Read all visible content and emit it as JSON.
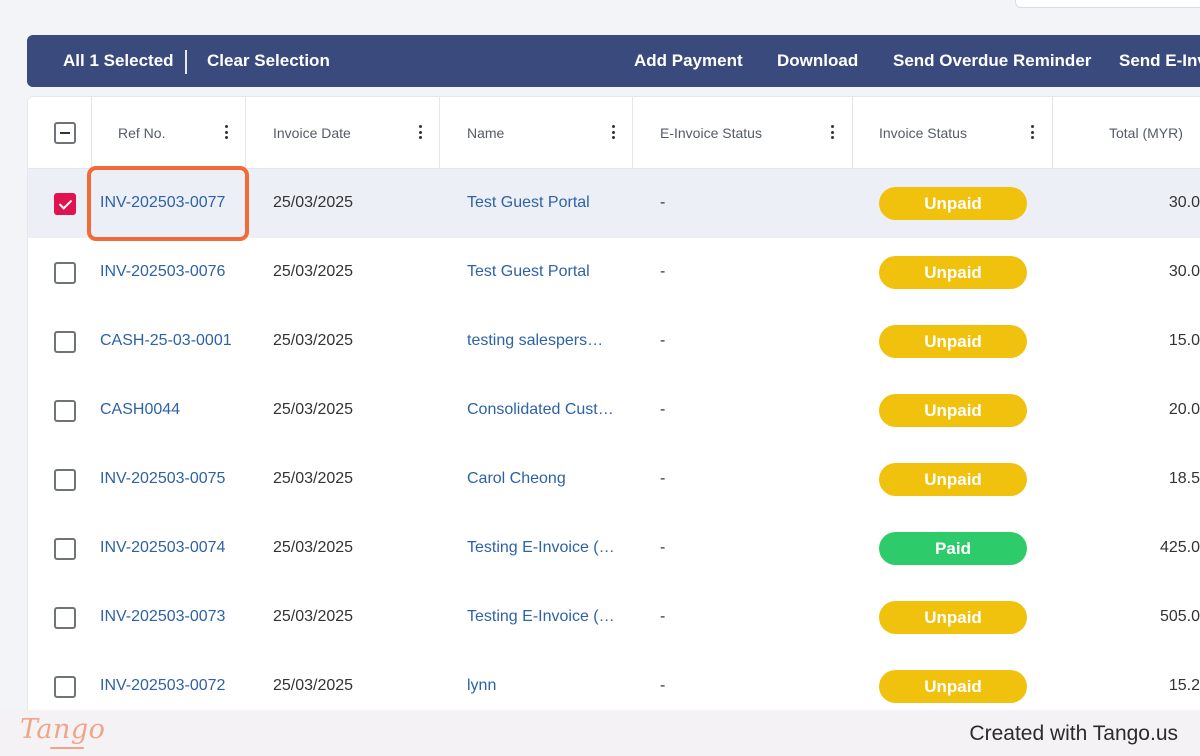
{
  "action_bar": {
    "selection_count": "All 1 Selected",
    "clear_selection": "Clear Selection",
    "add_payment": "Add Payment",
    "download": "Download",
    "send_overdue_reminder": "Send Overdue Reminder",
    "send_einvoice": "Send E-Inv"
  },
  "table": {
    "columns": [
      "Ref No.",
      "Invoice Date",
      "Name",
      "E-Invoice Status",
      "Invoice Status",
      "Total (MYR)"
    ],
    "rows": [
      {
        "ref": "INV-202503-0077",
        "date": "25/03/2025",
        "name": "Test Guest Portal",
        "einvoice_status": "-",
        "status": "Unpaid",
        "total": "30.0",
        "selected": true
      },
      {
        "ref": "INV-202503-0076",
        "date": "25/03/2025",
        "name": "Test Guest Portal",
        "einvoice_status": "-",
        "status": "Unpaid",
        "total": "30.0",
        "selected": false
      },
      {
        "ref": "CASH-25-03-0001",
        "date": "25/03/2025",
        "name": "testing salespers…",
        "einvoice_status": "-",
        "status": "Unpaid",
        "total": "15.0",
        "selected": false
      },
      {
        "ref": "CASH0044",
        "date": "25/03/2025",
        "name": "Consolidated Cust…",
        "einvoice_status": "-",
        "status": "Unpaid",
        "total": "20.0",
        "selected": false
      },
      {
        "ref": "INV-202503-0075",
        "date": "25/03/2025",
        "name": "Carol Cheong",
        "einvoice_status": "-",
        "status": "Unpaid",
        "total": "18.5",
        "selected": false
      },
      {
        "ref": "INV-202503-0074",
        "date": "25/03/2025",
        "name": "Testing E-Invoice (…",
        "einvoice_status": "-",
        "status": "Paid",
        "total": "425.0",
        "selected": false
      },
      {
        "ref": "INV-202503-0073",
        "date": "25/03/2025",
        "name": "Testing E-Invoice (…",
        "einvoice_status": "-",
        "status": "Unpaid",
        "total": "505.0",
        "selected": false
      },
      {
        "ref": "INV-202503-0072",
        "date": "25/03/2025",
        "name": "lynn",
        "einvoice_status": "-",
        "status": "Unpaid",
        "total": "15.2",
        "selected": false
      }
    ]
  },
  "status_colors": {
    "Unpaid": "#f0c20e",
    "Paid": "#2ecb6a"
  },
  "accent_color": "#e1134f",
  "highlight_color": "#f26a3a",
  "footer": {
    "logo": "Tango",
    "credit": "Created with Tango.us"
  }
}
